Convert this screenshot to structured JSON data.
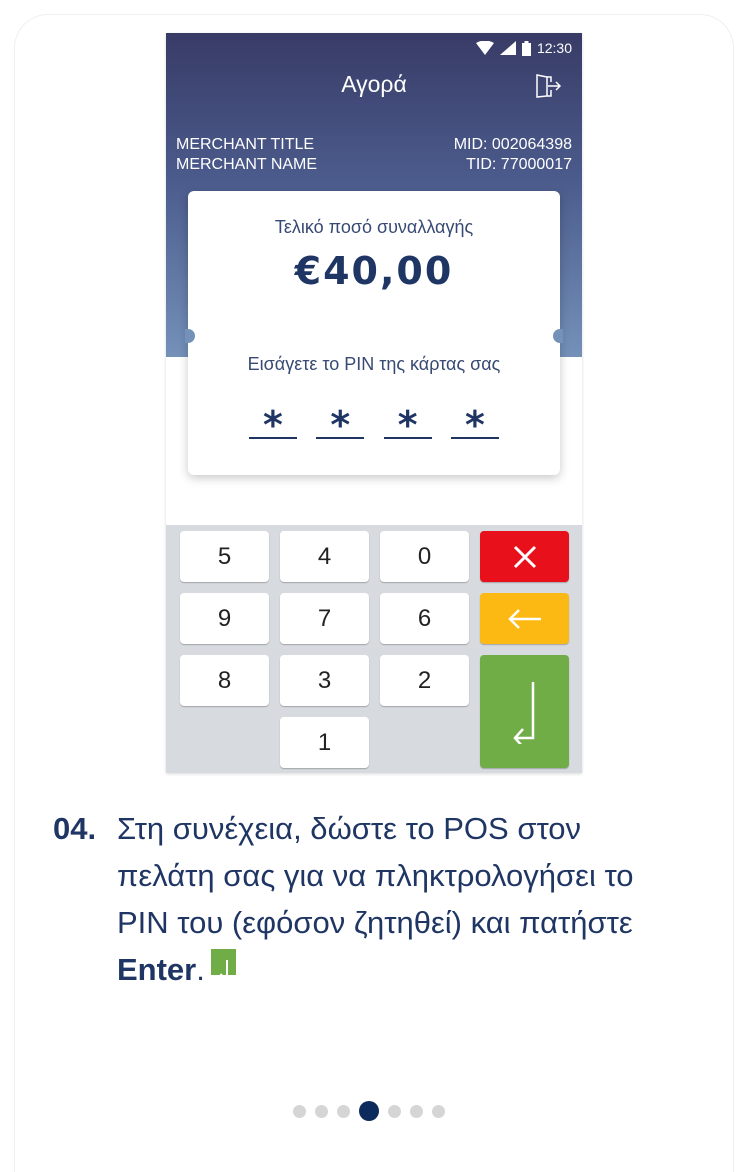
{
  "status_bar": {
    "time": "12:30"
  },
  "screen": {
    "title": "Αγορά",
    "merchant_title": "MERCHANT TITLE",
    "merchant_name": "MERCHANT NAME",
    "mid": "MID: 002064398",
    "tid": "TID: 77000017"
  },
  "amount_card": {
    "amount_label": "Τελικό ποσό συναλλαγής",
    "amount_value": "€40,00",
    "pin_label": "Εισάγετε το PIN της κάρτας σας",
    "pin_digits": [
      "*",
      "*",
      "*",
      "*"
    ]
  },
  "keypad": {
    "keys": [
      "5",
      "4",
      "0",
      "9",
      "7",
      "6",
      "8",
      "3",
      "2",
      "1"
    ],
    "cancel_icon": "close-icon",
    "back_icon": "arrow-left-icon",
    "enter_icon": "enter-icon",
    "colors": {
      "cancel": "#e8101b",
      "back": "#fcb813",
      "enter": "#70ad47"
    }
  },
  "caption": {
    "step": "04.",
    "text": "Στη συνέχεια, δώστε το POS στον πελάτη σας για να πληκτρολογήσει το PIN του (εφόσον ζητηθεί) και πατήστε ",
    "enter_word": "Enter",
    "period": "."
  },
  "pagination": {
    "total": 7,
    "active_index": 3
  },
  "colors": {
    "brand_dark": "#1f3664",
    "active_dot": "#0d2a5c"
  }
}
